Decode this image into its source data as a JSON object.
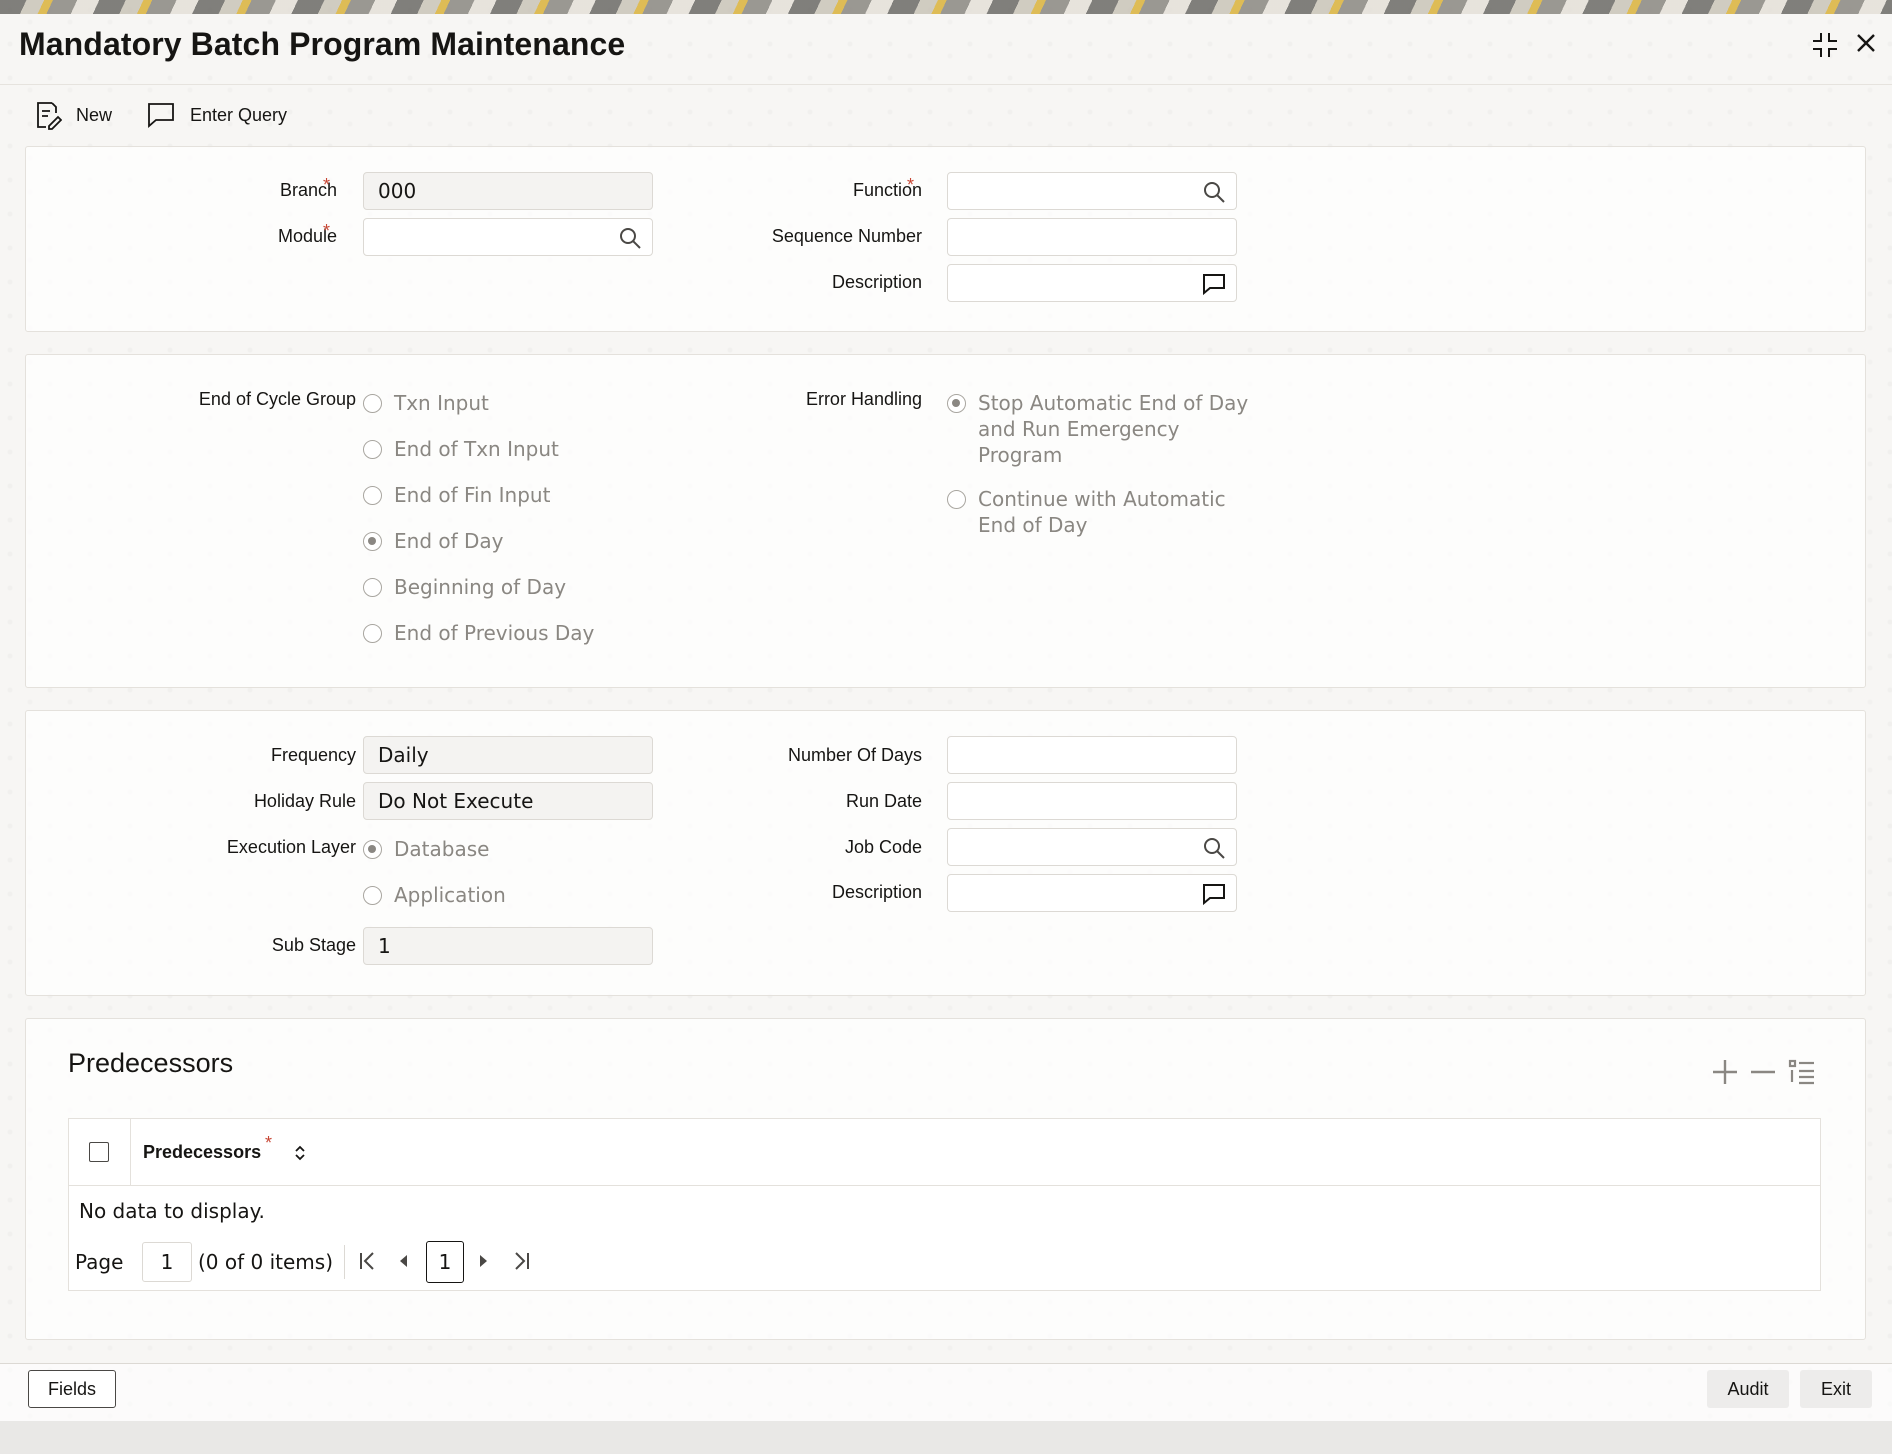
{
  "window": {
    "title": "Mandatory Batch Program Maintenance"
  },
  "toolbar": {
    "new_label": "New",
    "enter_query_label": "Enter Query"
  },
  "header_section": {
    "branch_label": "Branch",
    "branch_value": "000",
    "module_label": "Module",
    "module_value": "",
    "function_label": "Function",
    "function_value": "",
    "sequence_number_label": "Sequence Number",
    "sequence_number_value": "",
    "description_label": "Description",
    "description_value": ""
  },
  "cycle_section": {
    "end_of_cycle_group_label": "End of Cycle Group",
    "end_of_cycle_options": [
      {
        "label": "Txn Input",
        "selected": false
      },
      {
        "label": "End of Txn Input",
        "selected": false
      },
      {
        "label": "End of Fin Input",
        "selected": false
      },
      {
        "label": "End of Day",
        "selected": true
      },
      {
        "label": "Beginning of Day",
        "selected": false
      },
      {
        "label": "End of Previous Day",
        "selected": false
      }
    ],
    "error_handling_label": "Error Handling",
    "error_handling_options": [
      {
        "label": "Stop Automatic End of Day and Run Emergency Program",
        "line1": "Stop Automatic End of Day",
        "line2": "and Run Emergency",
        "line3": "Program",
        "selected": true
      },
      {
        "label": "Continue with Automatic End of Day",
        "line1": "Continue with Automatic",
        "line2": "End of Day",
        "selected": false
      }
    ]
  },
  "schedule_section": {
    "frequency_label": "Frequency",
    "frequency_value": "Daily",
    "holiday_rule_label": "Holiday Rule",
    "holiday_rule_value": "Do Not Execute",
    "execution_layer_label": "Execution Layer",
    "execution_layer_options": [
      {
        "label": "Database",
        "selected": true
      },
      {
        "label": "Application",
        "selected": false
      }
    ],
    "sub_stage_label": "Sub Stage",
    "sub_stage_value": "1",
    "number_of_days_label": "Number Of Days",
    "number_of_days_value": "",
    "run_date_label": "Run Date",
    "run_date_value": "",
    "job_code_label": "Job Code",
    "job_code_value": "",
    "description_label": "Description",
    "description_value": ""
  },
  "predecessors": {
    "section_title": "Predecessors",
    "column_header": "Predecessors",
    "empty_message": "No data to display.",
    "pager": {
      "page_label": "Page",
      "page_input": "1",
      "items_text": "(0 of 0 items)",
      "current_page": "1"
    }
  },
  "footer": {
    "fields_label": "Fields",
    "audit_label": "Audit",
    "exit_label": "Exit"
  },
  "colors": {
    "required": "#c74634",
    "disabled_text": "#8a8782",
    "border": "#dcd9d4"
  },
  "icons": [
    "new-document-icon",
    "chat-bubble-icon",
    "search-icon",
    "comment-icon",
    "minimize-icon",
    "close-icon",
    "add-icon",
    "remove-icon",
    "list-icon",
    "sort-icon",
    "first-page-icon",
    "prev-page-icon",
    "next-page-icon",
    "last-page-icon"
  ]
}
